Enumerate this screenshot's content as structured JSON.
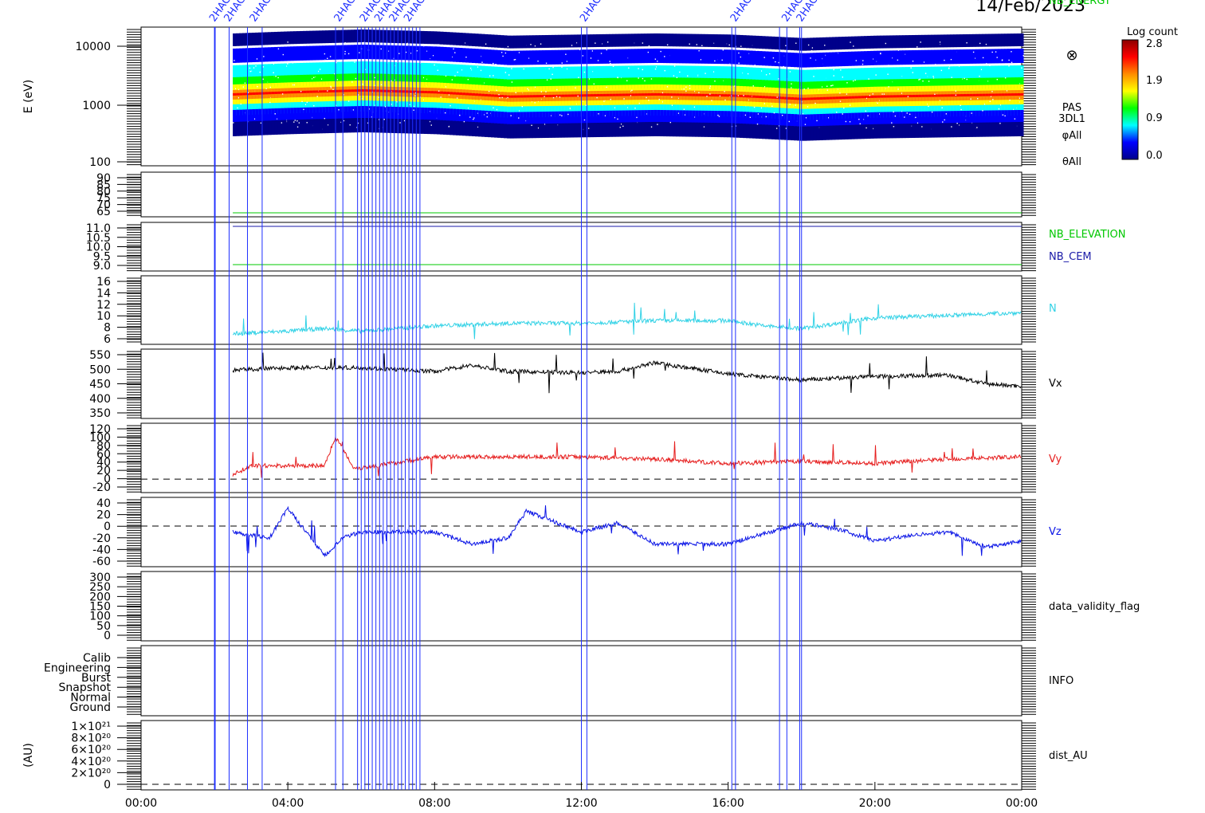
{
  "date_label": "14/Feb/2023",
  "colorbar": {
    "title": "Log count",
    "ticks": [
      "2.8",
      "1.9",
      "0.9",
      "0.0"
    ],
    "colors": [
      "#8b0000",
      "#ff0000",
      "#ff8c00",
      "#ffff00",
      "#00ff00",
      "#00ffff",
      "#0000ff",
      "#00008b"
    ]
  },
  "event_marker_color": "#1f2fff",
  "event_labels": [
    "2HAC",
    "2HAC",
    "2HAC",
    "2HAC",
    "2HAC",
    "2HAC",
    "2HAC",
    "2HAC",
    "2HAC",
    "2HAC",
    "2HAC",
    "2HAC"
  ],
  "chart_data": [
    {
      "type": "heatmap",
      "name": "PAS 3DL1 energy spectrogram",
      "ylabel": "E (eV)",
      "yscale": "log",
      "ylim": [
        100,
        15000
      ],
      "yticks": [
        "10000",
        "1000",
        "100"
      ],
      "right_labels": [
        "⊗",
        "PAS",
        "3DL1",
        "φAll",
        "θAll"
      ],
      "peak_energy_ev": [
        1300,
        1400,
        1500,
        1400,
        1200,
        1250,
        1300,
        1250,
        1100,
        1200,
        1300
      ],
      "x_hours": [
        2.5,
        4,
        6,
        8,
        10,
        12,
        14,
        16,
        18,
        20,
        24
      ]
    },
    {
      "type": "line",
      "yticks": [
        "90",
        "85",
        "80",
        "75",
        "70",
        "65"
      ],
      "series": [
        {
          "name": "NB_ENERGY",
          "color": "#00c800",
          "values": [
            65,
            65
          ]
        }
      ],
      "x_hours": [
        2.5,
        24
      ]
    },
    {
      "type": "line",
      "yticks": [
        "11.0",
        "10.5",
        "10.0",
        "9.5",
        "9.0"
      ],
      "series": [
        {
          "name": "NB_ELEVATION",
          "color": "#00c800",
          "values": [
            9.0,
            9.0
          ]
        },
        {
          "name": "NB_CEM",
          "color": "#1a1aa8",
          "values": [
            11.0,
            11.0
          ]
        }
      ],
      "x_hours": [
        2.5,
        24
      ]
    },
    {
      "type": "line",
      "yticks": [
        "16",
        "14",
        "12",
        "10",
        "8",
        "6"
      ],
      "ylim": [
        4.5,
        17.5
      ],
      "series": [
        {
          "name": "N",
          "color": "#32d2e6",
          "x_hours": [
            2.5,
            4,
            5,
            6,
            8,
            10,
            12,
            14,
            16,
            17,
            18,
            20,
            22,
            24
          ],
          "values": [
            6.5,
            7,
            7.5,
            7,
            8,
            8.5,
            8.5,
            9,
            9,
            8,
            7.5,
            9.5,
            10,
            10.5
          ]
        }
      ]
    },
    {
      "type": "line",
      "yticks": [
        "550",
        "500",
        "450",
        "400",
        "350"
      ],
      "ylim": [
        310,
        590
      ],
      "series": [
        {
          "name": "Vx",
          "color": "#000000",
          "x_hours": [
            2.5,
            4,
            6,
            8,
            9,
            10,
            12,
            13,
            14,
            16,
            18,
            20,
            22,
            23,
            24
          ],
          "values": [
            505,
            515,
            515,
            500,
            525,
            500,
            495,
            500,
            535,
            490,
            465,
            480,
            485,
            450,
            440
          ]
        }
      ]
    },
    {
      "type": "line",
      "yticks": [
        "120",
        "100",
        "80",
        "60",
        "40",
        "20",
        "0",
        "-20"
      ],
      "ylim": [
        -30,
        125
      ],
      "zero_line": true,
      "series": [
        {
          "name": "Vy",
          "color": "#e61e1e",
          "x_hours": [
            2.5,
            3,
            4,
            5,
            5.3,
            5.8,
            6,
            8,
            10,
            12,
            14,
            16,
            18,
            20,
            22,
            24
          ],
          "values": [
            10,
            30,
            30,
            30,
            95,
            25,
            25,
            50,
            50,
            50,
            45,
            35,
            40,
            35,
            45,
            50
          ]
        }
      ]
    },
    {
      "type": "line",
      "yticks": [
        "40",
        "20",
        "0",
        "-20",
        "-40",
        "-60"
      ],
      "ylim": [
        -68,
        48
      ],
      "zero_line": true,
      "series": [
        {
          "name": "Vz",
          "color": "#0a14e6",
          "x_hours": [
            2.5,
            3.5,
            4,
            5,
            5.5,
            6,
            8,
            9,
            10,
            10.5,
            12,
            13,
            14,
            16,
            18,
            19,
            20,
            21,
            22,
            23,
            24
          ],
          "values": [
            -10,
            -20,
            30,
            -50,
            -20,
            -10,
            -10,
            -30,
            -20,
            25,
            -10,
            5,
            -30,
            -30,
            5,
            -5,
            -25,
            -15,
            -10,
            -35,
            -25
          ]
        }
      ]
    },
    {
      "type": "line",
      "yticks": [
        "300",
        "250",
        "200",
        "150",
        "100",
        "50",
        "0"
      ],
      "series": [
        {
          "name": "data_validity_flag",
          "color": "#000000",
          "values": []
        }
      ]
    },
    {
      "type": "line",
      "yticks": [
        "Calib",
        "Engineering",
        "Burst",
        "Snapshot",
        "Normal",
        "Ground"
      ],
      "series": [
        {
          "name": "INFO",
          "color": "#000000",
          "values": []
        }
      ]
    },
    {
      "type": "line",
      "ylabel": "(AU)",
      "yticks": [
        "1×10²¹",
        "8×10²⁰",
        "6×10²⁰",
        "4×10²⁰",
        "2×10²⁰",
        "0"
      ],
      "zero_line": true,
      "series": [
        {
          "name": "dist_AU",
          "color": "#000000",
          "values": []
        }
      ]
    }
  ],
  "x_axis": {
    "ticks": [
      "00:00",
      "04:00",
      "08:00",
      "12:00",
      "16:00",
      "20:00",
      "00:00"
    ],
    "range_hours": [
      0,
      24
    ]
  },
  "event_times_hours": [
    2.0,
    2.02,
    2.4,
    2.9,
    3.3,
    5.3,
    5.5,
    5.9,
    6.0,
    6.1,
    6.2,
    6.3,
    6.4,
    6.5,
    6.6,
    6.7,
    6.8,
    6.9,
    7.0,
    7.1,
    7.2,
    7.3,
    7.4,
    7.5,
    7.6,
    12.0,
    12.15,
    16.1,
    16.2,
    17.4,
    17.6,
    17.95,
    18.0
  ]
}
